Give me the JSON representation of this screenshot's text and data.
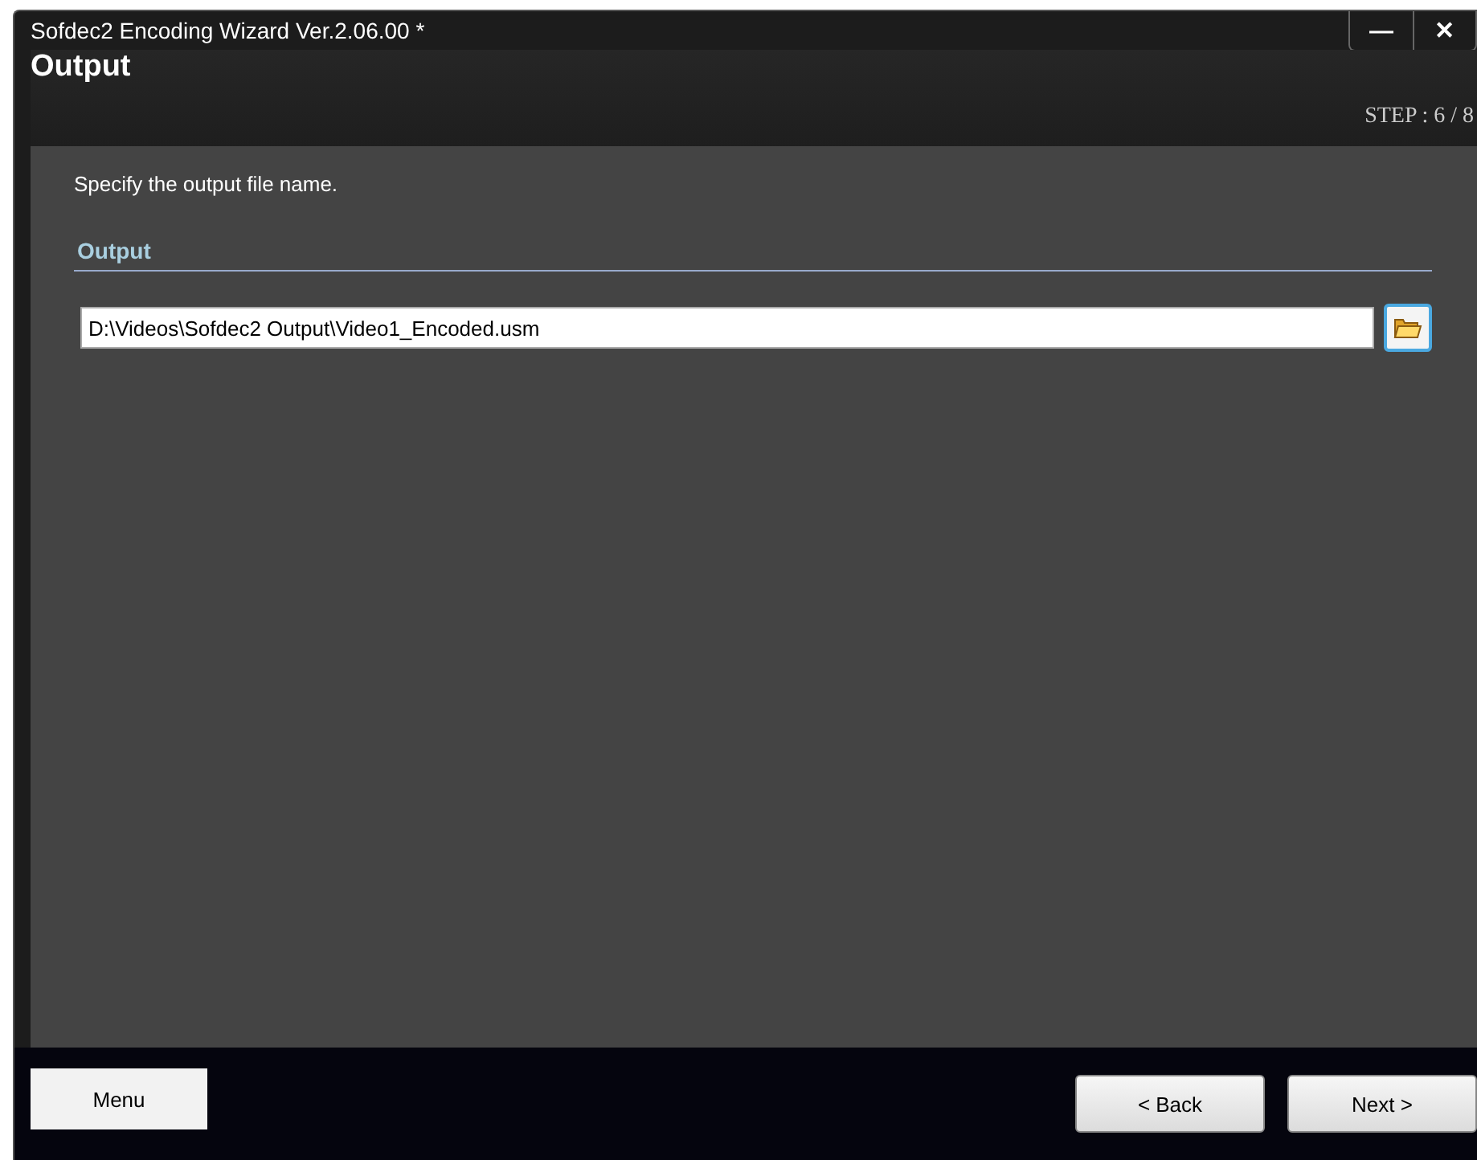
{
  "window": {
    "title": "Sofdec2 Encoding Wizard Ver.2.06.00 *",
    "controls": [
      "—",
      "✕"
    ]
  },
  "header": {
    "title": "Output",
    "step": "STEP : 6 / 8"
  },
  "instruction": "Specify the output file name.",
  "section": {
    "title": "Output",
    "field": {
      "value": "D:\\Videos\\Sofdec2 Output\\Video1_Encoded.usm"
    }
  },
  "footer": {
    "menu_button": "Menu",
    "buttons": [
      "< Back",
      "Next >"
    ]
  }
}
